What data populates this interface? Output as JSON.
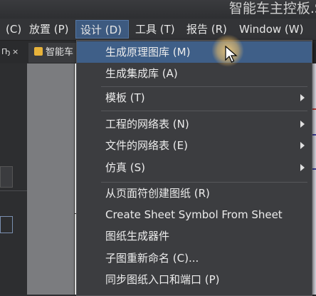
{
  "window": {
    "title": "智能车主控板.S"
  },
  "menubar": {
    "items": [
      {
        "label": "(C)"
      },
      {
        "label": "放置 (P)"
      },
      {
        "label": "设计 (D)"
      },
      {
        "label": "工具 (T)"
      },
      {
        "label": "报告 (R)"
      },
      {
        "label": "Window (W)"
      }
    ]
  },
  "tabs": {
    "panel_pin": "Ҧ",
    "panel_close": "×",
    "doc_tab_label": "智能车"
  },
  "design_menu": {
    "items": [
      {
        "label": "生成原理图库 (M)"
      },
      {
        "label": "生成集成库 (A)"
      },
      {
        "label": "模板 (T)"
      },
      {
        "label": "工程的网络表 (N)"
      },
      {
        "label": "文件的网络表 (E)"
      },
      {
        "label": "仿真 (S)"
      },
      {
        "label": "从页面符创建图纸 (R)"
      },
      {
        "label": "Create Sheet Symbol From Sheet"
      },
      {
        "label": "图纸生成器件"
      },
      {
        "label": "子图重新命名 (C)..."
      },
      {
        "label": "同步图纸入口和端口 (P)"
      }
    ]
  },
  "colors": {
    "highlight": "#3f5f88",
    "menu_bg": "#3c3d40",
    "active_menu": "#3d5a80"
  }
}
